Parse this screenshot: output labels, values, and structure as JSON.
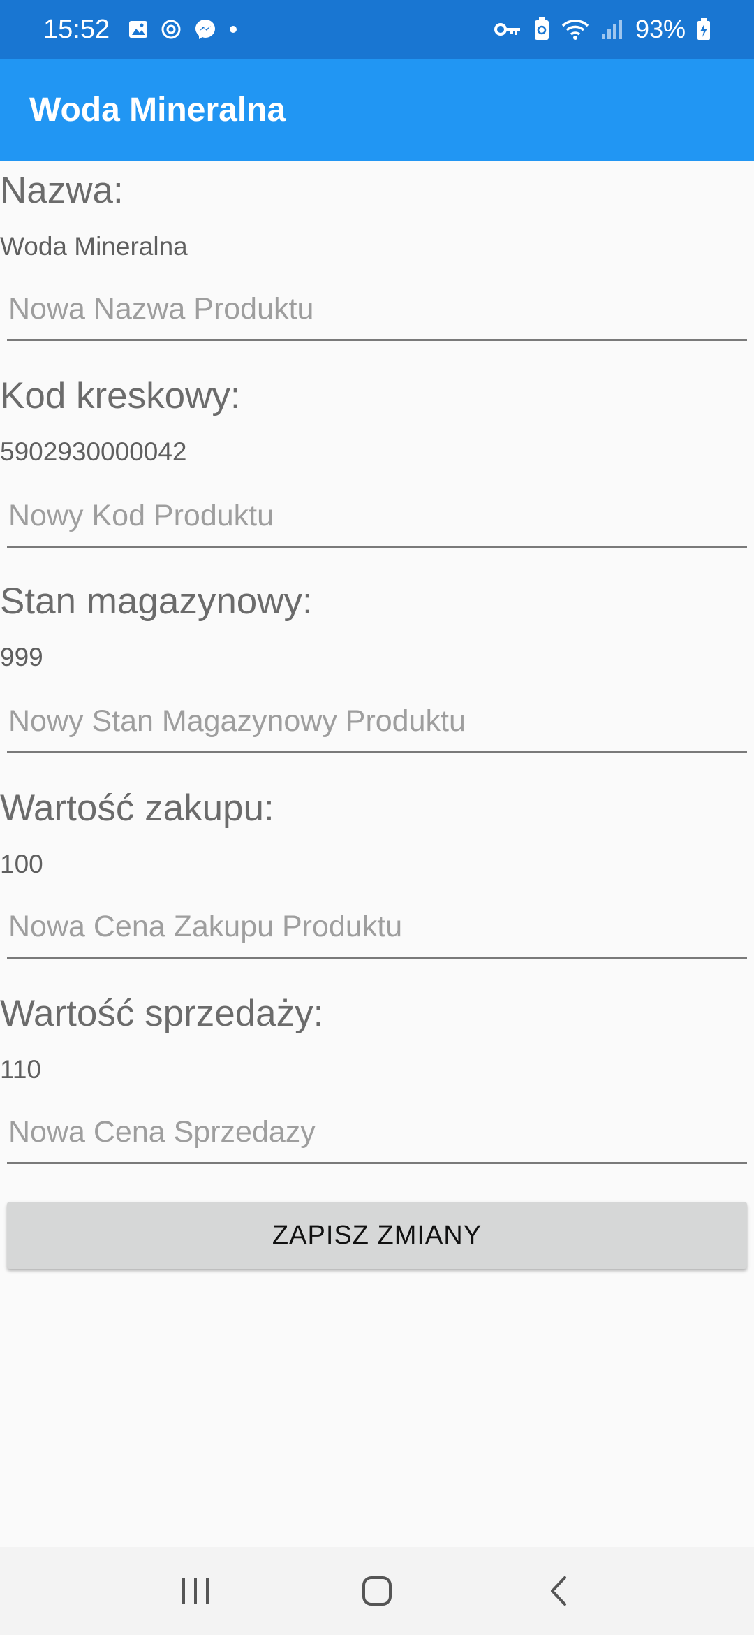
{
  "status_bar": {
    "time": "15:52",
    "battery": "93%",
    "left_icons": [
      "gallery-icon",
      "sync-icon",
      "messenger-icon",
      "dot-icon"
    ],
    "right_icons": [
      "vpn-key-icon",
      "battery-saver-icon",
      "wifi-icon",
      "signal-icon",
      "battery-charging-icon"
    ]
  },
  "app_bar": {
    "title": "Woda Mineralna",
    "color": "#2196f3",
    "status_color": "#1976d2"
  },
  "fields": [
    {
      "label": "Nazwa:",
      "value": "Woda Mineralna",
      "placeholder": "Nowa Nazwa Produktu"
    },
    {
      "label": "Kod kreskowy:",
      "value": "5902930000042",
      "placeholder": "Nowy Kod Produktu"
    },
    {
      "label": "Stan magazynowy:",
      "value": "999",
      "placeholder": "Nowy Stan Magazynowy Produktu"
    },
    {
      "label": "Wartość zakupu:",
      "value": "100",
      "placeholder": "Nowa Cena Zakupu Produktu"
    },
    {
      "label": "Wartość sprzedaży:",
      "value": "110",
      "placeholder": "Nowa Cena Sprzedazy"
    }
  ],
  "save_button": {
    "label": "ZAPISZ ZMIANY"
  },
  "nav_bar": {
    "buttons": [
      "recent-apps-icon",
      "home-icon",
      "back-icon"
    ]
  }
}
